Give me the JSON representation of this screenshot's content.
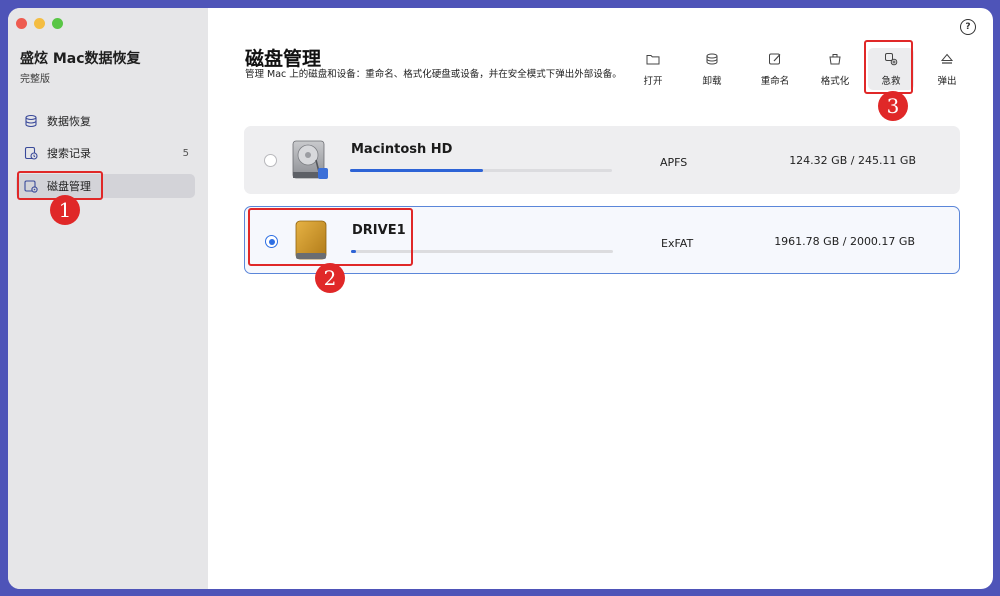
{
  "sidebar": {
    "app_title": "盛炫 Mac数据恢复",
    "edition": "完整版",
    "items": [
      {
        "label": "数据恢复",
        "icon": "database-icon"
      },
      {
        "label": "搜索记录",
        "icon": "history-icon",
        "badge": "5"
      },
      {
        "label": "磁盘管理",
        "icon": "disk-settings-icon",
        "active": true
      }
    ]
  },
  "header": {
    "title": "磁盘管理",
    "description": "管理 Mac 上的磁盘和设备：重命名、格式化硬盘或设备，并在安全模式下弹出外部设备。",
    "help_symbol": "?"
  },
  "toolbar": [
    {
      "label": "打开",
      "icon": "folder-icon"
    },
    {
      "label": "卸载",
      "icon": "unmount-icon"
    },
    {
      "label": "重命名",
      "icon": "rename-icon"
    },
    {
      "label": "格式化",
      "icon": "format-icon"
    },
    {
      "label": "急救",
      "icon": "first-aid-icon"
    },
    {
      "label": "弹出",
      "icon": "eject-icon"
    }
  ],
  "disks": [
    {
      "name": "Macintosh HD",
      "filesystem": "APFS",
      "capacity": "124.32 GB / 245.11 GB",
      "used_fraction": 0.507,
      "selected": false,
      "icon": "internal-drive-icon"
    },
    {
      "name": "DRIVE1",
      "filesystem": "ExFAT",
      "capacity": "1961.78 GB / 2000.17 GB",
      "used_fraction": 0.019,
      "selected": true,
      "icon": "external-drive-icon"
    }
  ],
  "annotations": [
    "1",
    "2",
    "3"
  ],
  "colors": {
    "accent": "#2d63d6",
    "callout": "#e02828",
    "frame": "#4e54b8"
  }
}
